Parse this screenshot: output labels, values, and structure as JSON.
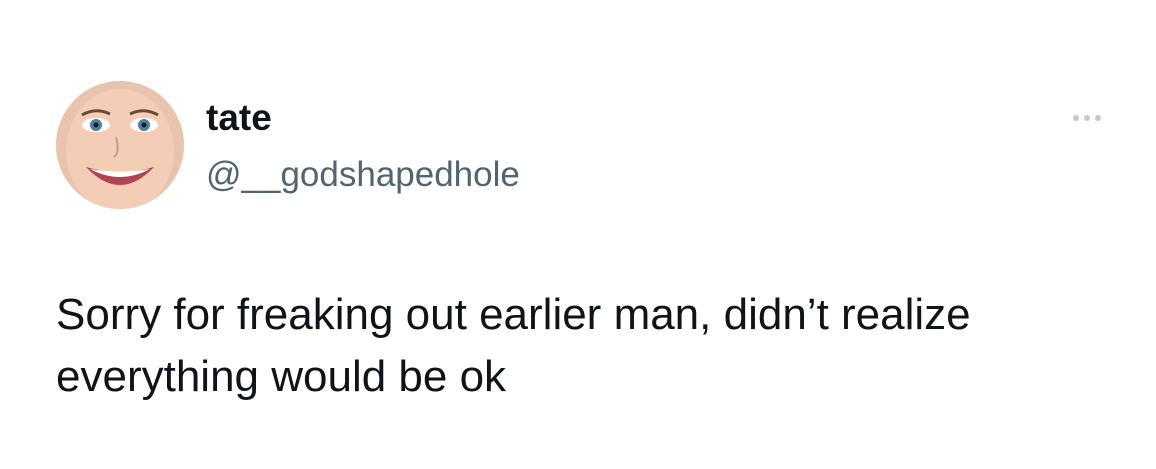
{
  "tweet": {
    "author": {
      "display_name": "tate",
      "handle": "@__godshapedhole",
      "avatar_icon": "profile-photo"
    },
    "more_icon": "more-dots-icon",
    "text": "Sorry for freaking out earlier man, didn’t realize everything would be ok"
  },
  "colors": {
    "text_primary": "#0f1419",
    "text_secondary": "#536471",
    "more_dots": "#c4c9cd",
    "background": "#ffffff"
  }
}
